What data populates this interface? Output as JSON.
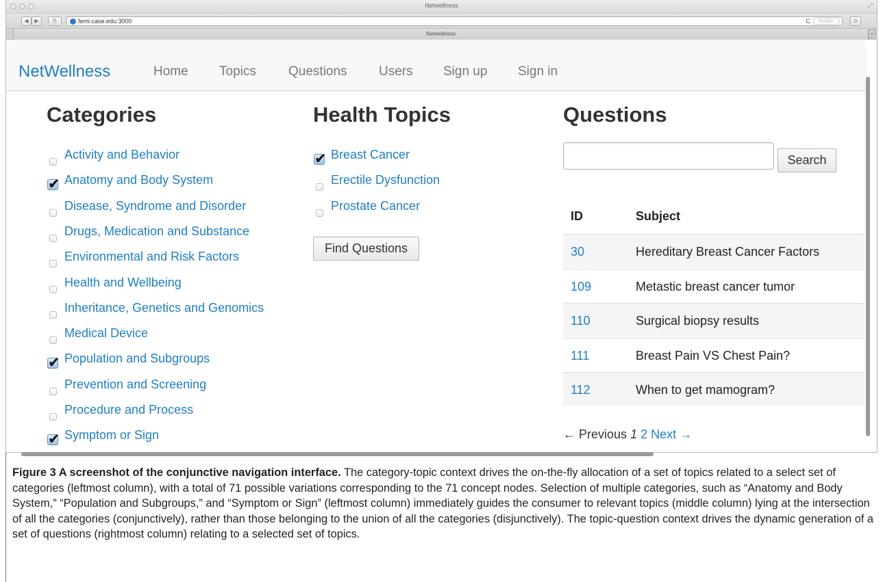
{
  "browser": {
    "window_title": "Netwellness",
    "url": "femi.case.edu:3000",
    "reader_label": "Reader",
    "tab_title": "Netwellness",
    "new_tab_glyph": "+",
    "reload_glyph": "C",
    "back_glyph": "◀",
    "forward_glyph": "▶",
    "share_glyph": "⎘",
    "resize_glyph": "⤢",
    "tools_glyph": "⊙"
  },
  "nav": {
    "brand": "NetWellness",
    "links": [
      "Home",
      "Topics",
      "Questions",
      "Users",
      "Sign up",
      "Sign in"
    ]
  },
  "categories": {
    "title": "Categories",
    "items": [
      {
        "label": "Activity and Behavior",
        "checked": false
      },
      {
        "label": "Anatomy and Body System",
        "checked": true
      },
      {
        "label": "Disease, Syndrome and Disorder",
        "checked": false
      },
      {
        "label": "Drugs, Medication and Substance",
        "checked": false
      },
      {
        "label": "Environmental and Risk Factors",
        "checked": false
      },
      {
        "label": "Health and Wellbeing",
        "checked": false
      },
      {
        "label": "Inheritance, Genetics and Genomics",
        "checked": false
      },
      {
        "label": "Medical Device",
        "checked": false
      },
      {
        "label": "Population and Subgroups",
        "checked": true
      },
      {
        "label": "Prevention and Screening",
        "checked": false
      },
      {
        "label": "Procedure and Process",
        "checked": false
      },
      {
        "label": "Symptom or Sign",
        "checked": true
      }
    ]
  },
  "topics": {
    "title": "Health Topics",
    "items": [
      {
        "label": "Breast Cancer",
        "checked": true
      },
      {
        "label": "Erectile Dysfunction",
        "checked": false
      },
      {
        "label": "Prostate Cancer",
        "checked": false
      }
    ],
    "find_button": "Find Questions"
  },
  "questions": {
    "title": "Questions",
    "search_value": "",
    "search_button": "Search",
    "columns": [
      "ID",
      "Subject"
    ],
    "rows": [
      {
        "id": "30",
        "subject": "Hereditary Breast Cancer Factors"
      },
      {
        "id": "109",
        "subject": "Metastic breast cancer tumor"
      },
      {
        "id": "110",
        "subject": "Surgical biopsy results"
      },
      {
        "id": "111",
        "subject": "Breast Pain VS Chest Pain?"
      },
      {
        "id": "112",
        "subject": "When to get mamogram?"
      }
    ],
    "pager": {
      "previous": "← Previous",
      "current": "1",
      "next_page": "2",
      "next": "Next →"
    }
  },
  "caption": {
    "lead": "Figure 3 A screenshot of the conjunctive navigation interface.",
    "body": " The category-topic context drives the on-the-fly allocation of a set of topics related to a select set of categories (leftmost column), with a total of 71 possible variations corresponding to the 71 concept nodes. Selection of multiple categories, such as “Anatomy and Body System,” “Population and Subgroups,” and “Symptom or Sign” (leftmost column) immediately guides the consumer to relevant topics (middle column) lying at the intersection of all the categories (conjunctively), rather than those belonging to the union of all the categories (disjunctively). The topic-question context drives the dynamic generation of a set of questions (rightmost column) relating to a selected set of topics."
  },
  "colors": {
    "link": "#1f7fc4",
    "brand": "#1f7fc4",
    "nav_text": "#777777",
    "row_stripe": "#f5f5f5"
  }
}
